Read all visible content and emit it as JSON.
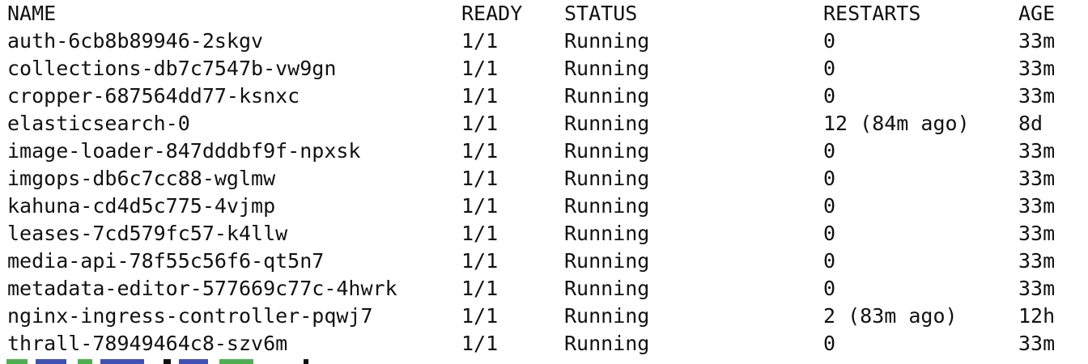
{
  "terminal": {
    "headers": {
      "name": "NAME",
      "ready": "READY",
      "status": "STATUS",
      "restarts": "RESTARTS",
      "age": "AGE"
    },
    "rows": [
      {
        "name": "auth-6cb8b89946-2skgv",
        "ready": "1/1",
        "status": "Running",
        "restarts": "0",
        "age": "33m"
      },
      {
        "name": "collections-db7c7547b-vw9gn",
        "ready": "1/1",
        "status": "Running",
        "restarts": "0",
        "age": "33m"
      },
      {
        "name": "cropper-687564dd77-ksnxc",
        "ready": "1/1",
        "status": "Running",
        "restarts": "0",
        "age": "33m"
      },
      {
        "name": "elasticsearch-0",
        "ready": "1/1",
        "status": "Running",
        "restarts": "12 (84m ago)",
        "age": "8d"
      },
      {
        "name": "image-loader-847dddbf9f-npxsk",
        "ready": "1/1",
        "status": "Running",
        "restarts": "0",
        "age": "33m"
      },
      {
        "name": "imgops-db6c7cc88-wglmw",
        "ready": "1/1",
        "status": "Running",
        "restarts": "0",
        "age": "33m"
      },
      {
        "name": "kahuna-cd4d5c775-4vjmp",
        "ready": "1/1",
        "status": "Running",
        "restarts": "0",
        "age": "33m"
      },
      {
        "name": "leases-7cd579fc57-k4llw",
        "ready": "1/1",
        "status": "Running",
        "restarts": "0",
        "age": "33m"
      },
      {
        "name": "media-api-78f55c56f6-qt5n7",
        "ready": "1/1",
        "status": "Running",
        "restarts": "0",
        "age": "33m"
      },
      {
        "name": "metadata-editor-577669c77c-4hwrk",
        "ready": "1/1",
        "status": "Running",
        "restarts": "0",
        "age": "33m"
      },
      {
        "name": "nginx-ingress-controller-pqwj7",
        "ready": "1/1",
        "status": "Running",
        "restarts": "2 (83m ago)",
        "age": "12h"
      },
      {
        "name": "thrall-78949464c8-szv6m",
        "ready": "1/1",
        "status": "Running",
        "restarts": "0",
        "age": "33m"
      }
    ]
  },
  "colors": {
    "background": "#ffffff",
    "text": "#111111",
    "prompt_fragment": [
      "#4caf50",
      "#3f51b5",
      "#4caf50",
      "#3f51b5",
      "#111111",
      "#3f51b5",
      "#4caf50",
      "#111111"
    ]
  }
}
